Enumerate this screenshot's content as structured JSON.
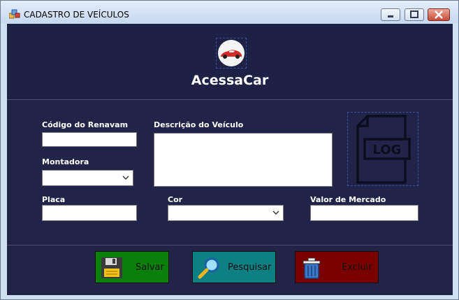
{
  "window": {
    "title": "CADASTRO DE VEÍCULOS",
    "controls": [
      "minimize-icon",
      "maximize-icon",
      "close-icon"
    ]
  },
  "header": {
    "brand": "AcessaCar",
    "logo_icon": "red-car-icon"
  },
  "form": {
    "renavam_label": "Código do Renavam",
    "renavam_value": "",
    "descricao_label": "Descrição do Veículo",
    "descricao_value": "",
    "montadora_label": "Montadora",
    "montadora_value": "",
    "placa_label": "Placa",
    "placa_value": "",
    "cor_label": "Cor",
    "cor_value": "",
    "valor_label": "Valor de Mercado",
    "valor_value": "",
    "log_image_text": "LOG"
  },
  "buttons": {
    "salvar": "Salvar",
    "pesquisar": "Pesquisar",
    "excluir": "Excluir"
  },
  "colors": {
    "background": "#212448",
    "salvar": "#0a7f0a",
    "pesquisar": "#0e7f83",
    "excluir": "#7a0000"
  }
}
